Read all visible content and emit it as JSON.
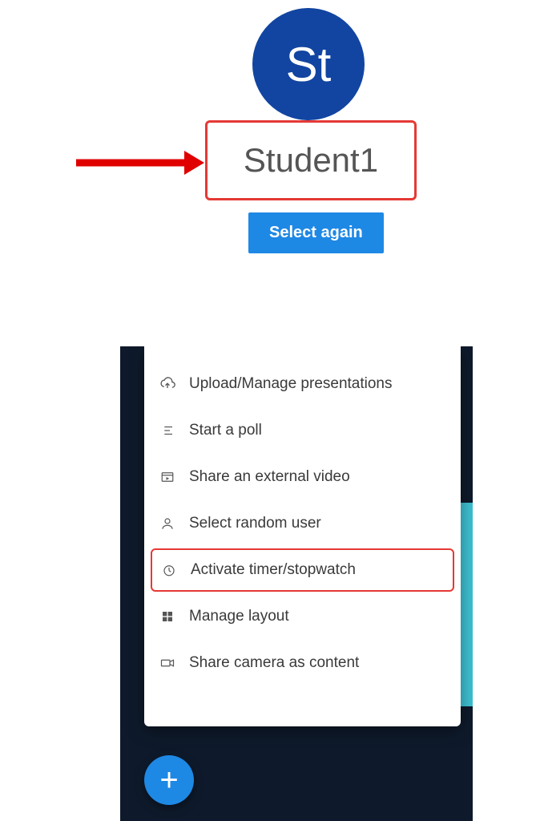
{
  "top": {
    "avatar_initials": "St",
    "student_name": "Student1",
    "select_button": "Select again"
  },
  "menu": {
    "items": [
      {
        "label": "Upload/Manage presentations",
        "icon": "upload-icon"
      },
      {
        "label": "Start a poll",
        "icon": "poll-icon"
      },
      {
        "label": "Share an external video",
        "icon": "video-icon"
      },
      {
        "label": "Select random user",
        "icon": "user-icon"
      },
      {
        "label": "Activate timer/stopwatch",
        "icon": "clock-icon",
        "highlighted": true
      },
      {
        "label": "Manage layout",
        "icon": "layout-icon"
      },
      {
        "label": "Share camera as content",
        "icon": "camera-icon"
      }
    ]
  },
  "fab": {
    "label": "+"
  },
  "colors": {
    "brand_blue": "#1245a1",
    "button_blue": "#1e88e5",
    "highlight_red": "#e53935",
    "dark_panel": "#0e1a2b",
    "teal": "#3ec1d3"
  }
}
